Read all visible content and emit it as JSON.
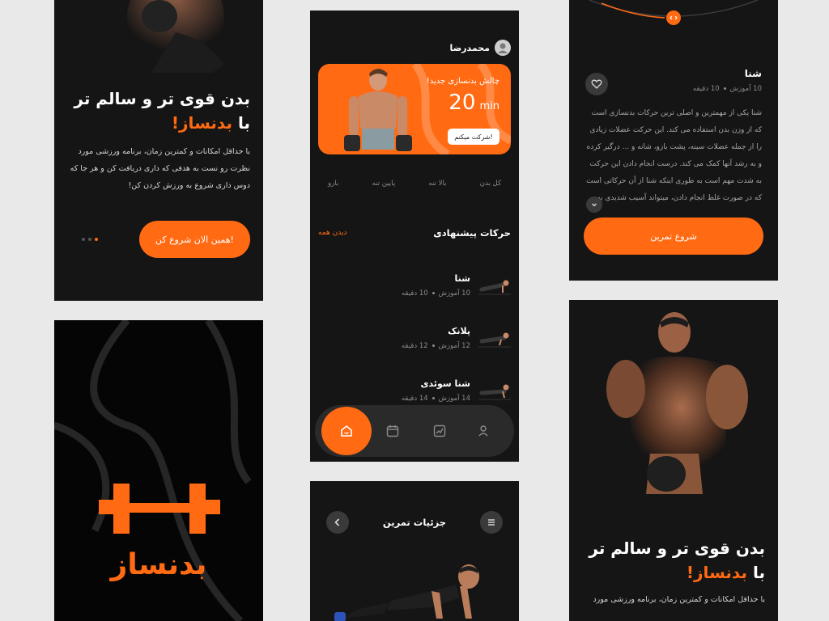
{
  "colors": {
    "accent": "#ff6a13",
    "screen_bg": "#151515",
    "page_bg": "#e9e9e9"
  },
  "onboarding": {
    "title_line1": "بدن قوی تر و سالم تر",
    "title_line2_prefix": "با",
    "title_line2_brand": "بدنساز!",
    "description": "با حداقل امکانات و کمترین زمان، برنامه ورزشی مورد نظرت رو نست به هدفی که داری دریافت کن و هر جا که دوس داری شروع به ورزش کردن کن!",
    "cta": "همین الان شروع کن!"
  },
  "onboarding_bottom": {
    "title_line1": "بدن قوی تر و سالم تر",
    "title_line2_prefix": "با",
    "title_line2_brand": "بدنساز!",
    "description": "با حداقل امکانات و کمترین زمان، برنامه ورزشی مورد"
  },
  "splash": {
    "brand": "بدنساز",
    "logo_icon": "dumbbell-icon"
  },
  "home": {
    "username": "محمدرضا",
    "challenge": {
      "subtitle": "چالش بدنسازی جدید!",
      "minutes": "20",
      "unit": "min",
      "button": "شرکت میکنم!"
    },
    "categories": [
      "کل بدن",
      "بالا تنه",
      "پایین تنه",
      "بازو"
    ],
    "suggested_title": "حرکات پیشنهادی",
    "see_all": "دیدن همه",
    "exercises": [
      {
        "name": "شنا",
        "lessons": "10 آموزش",
        "duration": "10 دقیقه"
      },
      {
        "name": "پلانک",
        "lessons": "12 آموزش",
        "duration": "12 دقیقه"
      },
      {
        "name": "شنا سوئدی",
        "lessons": "14 آموزش",
        "duration": "14 دقیقه"
      }
    ],
    "nav": [
      "home-icon",
      "calendar-icon",
      "chart-icon",
      "user-icon"
    ]
  },
  "detail": {
    "name": "شنا",
    "lessons": "10 آموزش",
    "duration": "10 دقیقه",
    "body": "شنا یکی از مهمترین و اصلی ترین حرکات بدنسازی است که از وزن بدن استفاده می کند. این حرکت عضلات زیادی را از جمله عضلات سینه، پشت بازو، شانه و ... درگیر کرده و به رشد آنها کمک می کند. درست انجام دادن این حرکت به شدت مهم است به طوری اینکه شنا از آن حرکاتی است که در صورت غلط انجام دادن، میتواند آسیب شدیدی به عضلات",
    "button": "شروع تمرین"
  },
  "exercise_details": {
    "title": "جزئیات تمرین"
  }
}
